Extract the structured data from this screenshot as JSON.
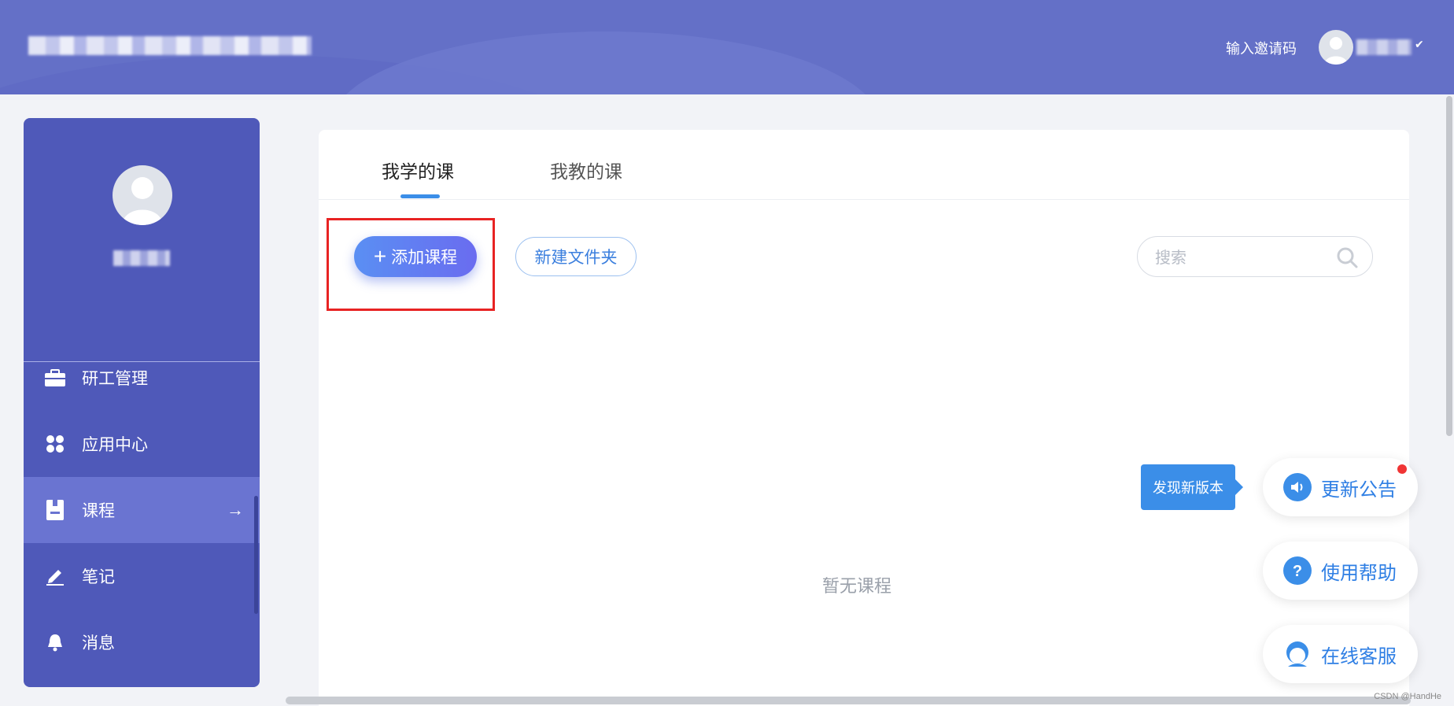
{
  "header": {
    "title": "",
    "invite_label": "输入邀请码",
    "user_name": ""
  },
  "sidebar": {
    "user_name": "",
    "items": [
      {
        "label": "研工管理",
        "icon": "briefcase-icon"
      },
      {
        "label": "应用中心",
        "icon": "app-grid-icon"
      },
      {
        "label": "课程",
        "icon": "book-icon",
        "active": true
      },
      {
        "label": "笔记",
        "icon": "pen-icon"
      },
      {
        "label": "消息",
        "icon": "bell-icon"
      }
    ]
  },
  "main": {
    "tabs": [
      {
        "label": "我学的课",
        "active": true
      },
      {
        "label": "我教的课",
        "active": false
      }
    ],
    "add_course_label": "添加课程",
    "new_folder_label": "新建文件夹",
    "search": {
      "placeholder": "搜索",
      "value": ""
    },
    "empty_text": "暂无课程"
  },
  "floating": {
    "tip_label": "发现新版本",
    "buttons": [
      {
        "label": "更新公告",
        "icon": "speaker-icon"
      },
      {
        "label": "使用帮助",
        "icon": "help-icon"
      },
      {
        "label": "在线客服",
        "icon": "support-icon"
      }
    ]
  },
  "watermark": "CSDN @HandHe",
  "colors": {
    "header": "#6470c7",
    "sidebar": "#4f59b9",
    "sidebar_active": "#6a74d1",
    "accent": "#3b8ee8",
    "highlight_box": "#e82323"
  }
}
